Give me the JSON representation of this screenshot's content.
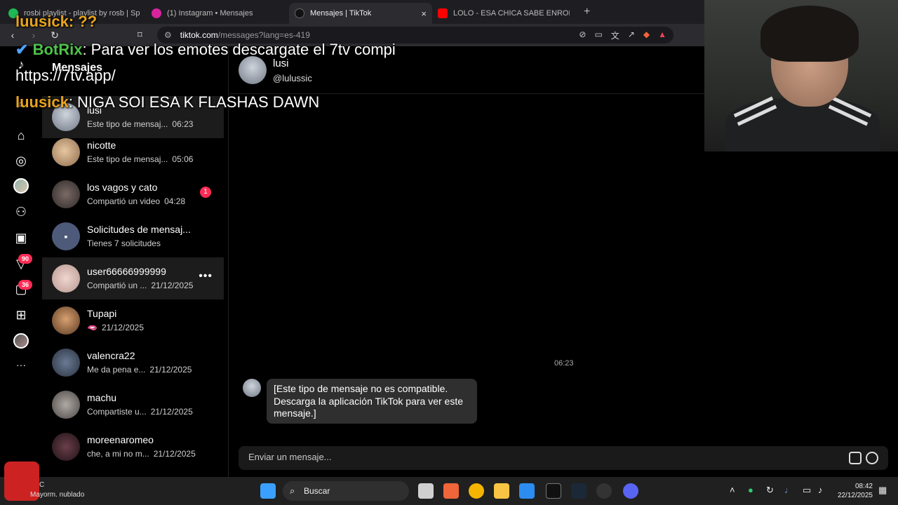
{
  "browser": {
    "tabs": [
      {
        "title": "rosbi playlist - playlist by rosb | Spotify",
        "color": "#1db954",
        "active": false
      },
      {
        "title": "(1) Instagram • Mensajes",
        "color": "#d6249f",
        "active": false
      },
      {
        "title": "Mensajes | TikTok",
        "color": "#111111",
        "active": true
      },
      {
        "title": "LOLO - ESA CHICA SABE ENROLAR - YouTube",
        "color": "#ff0000",
        "active": false
      }
    ],
    "new_tab": "+",
    "close": "×",
    "url_host": "tiktok.com",
    "url_path": "/messages?lang=es-419"
  },
  "rail": {
    "badge_notifications": "90",
    "badge_messages": "36",
    "more": "···"
  },
  "list": {
    "title": "Mensajes",
    "conversations": [
      {
        "name": "lusi",
        "snippet": "Este tipo de mensaj...",
        "time": "06:23",
        "highlight": true
      },
      {
        "name": "nicotte",
        "snippet": "Este tipo de mensaj...",
        "time": "05:06"
      },
      {
        "name": "los vagos y cato",
        "snippet": "Compartió un video",
        "time": "04:28",
        "unread": "1"
      },
      {
        "name": "Solicitudes de mensaj...",
        "snippet": "Tienes 7 solicitudes",
        "time": ""
      },
      {
        "name": "user66666999999",
        "snippet": "Compartió un ...",
        "time": "21/12/2025",
        "hover": true
      },
      {
        "name": "Tupapi",
        "snippet": "🫦",
        "time": "21/12/2025"
      },
      {
        "name": "valencra22",
        "snippet": "Me da pena e...",
        "time": "21/12/2025"
      },
      {
        "name": "machu",
        "snippet": "Compartiste u...",
        "time": "21/12/2025"
      },
      {
        "name": "moreenaromeo",
        "snippet": "che, a mi no m...",
        "time": "21/12/2025"
      }
    ],
    "more_icon": "•••"
  },
  "chat": {
    "nickname": "lusi",
    "handle": "@lulussic",
    "timestamp": "06:23",
    "message": "[Este tipo de mensaje no es compatible. Descarga la aplicación TikTok para ver este mensaje.]",
    "placeholder": "Enviar un mensaje..."
  },
  "overlay": {
    "line1_user": "luusick",
    "line1_text": ": ??",
    "line2_user": "BotRix",
    "line2_text": ": Para ver los emotes descargate el 7tv compi",
    "line3_text": "https://7tv.app/",
    "line4_user": "luusick",
    "line4_text": ": NIGA SOI ESA K FLASHAS DAWN"
  },
  "taskbar": {
    "weather": "Mayorm. nublado",
    "weather_temp": "C",
    "search": "Buscar",
    "time": "08:42",
    "date": "22/12/2025"
  }
}
